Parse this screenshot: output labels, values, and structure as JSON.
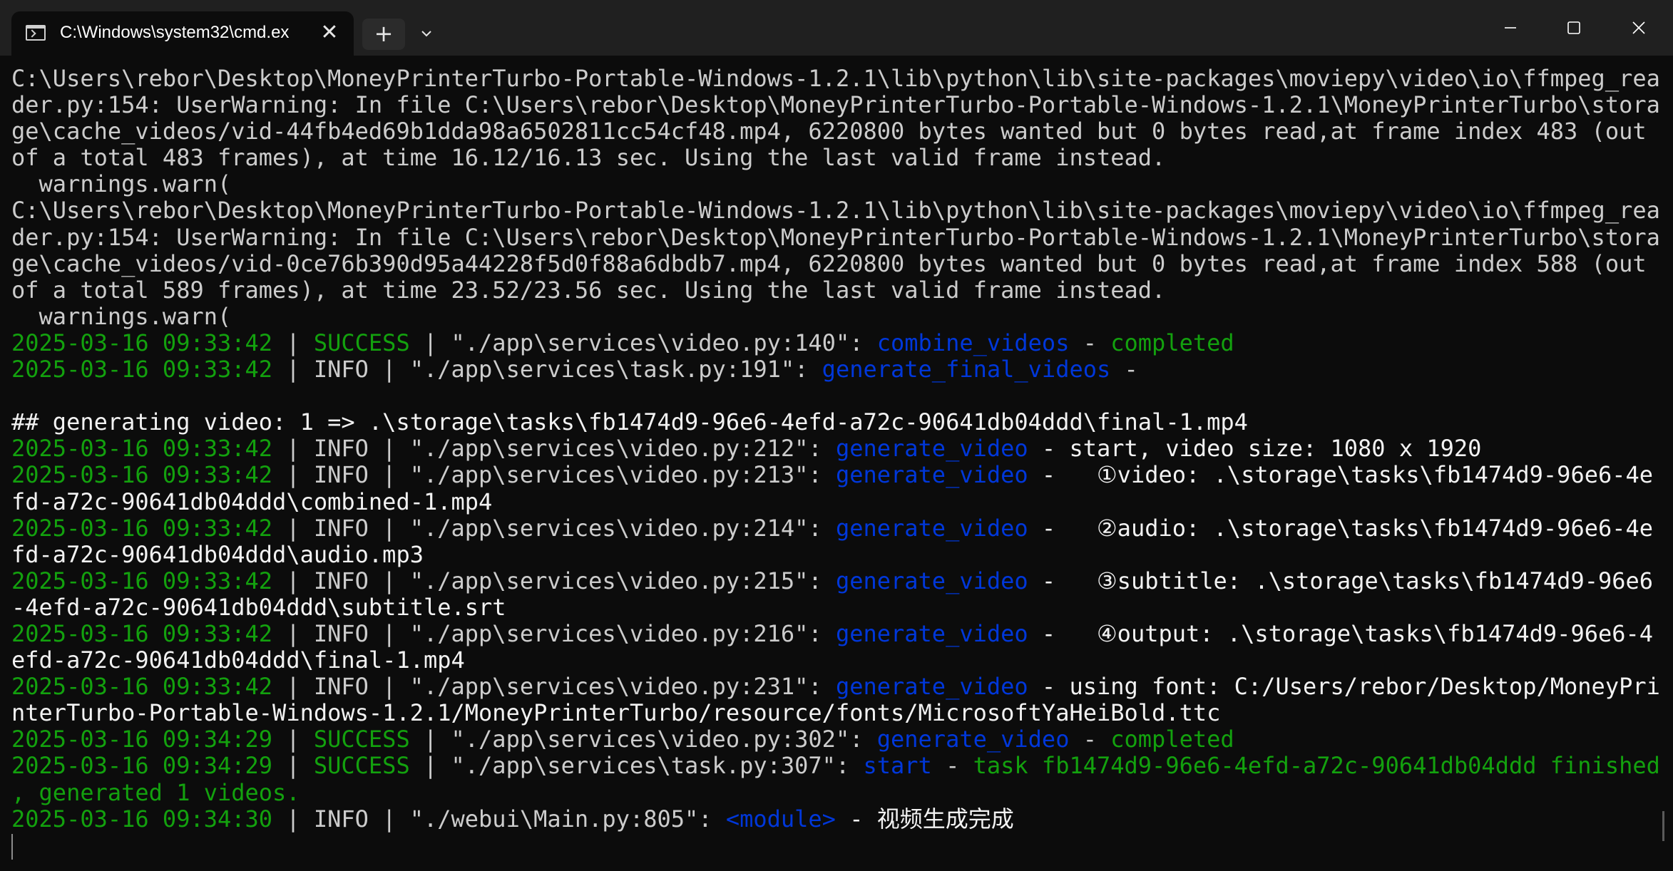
{
  "window": {
    "tab_title": "C:\\Windows\\system32\\cmd.ex",
    "new_tab_glyph": "+",
    "close_tab_glyph": "✕"
  },
  "icons": {
    "tab": "terminal-icon",
    "close_tab": "close-icon",
    "new_tab": "plus-icon",
    "dropdown": "chevron-down-icon",
    "minimize": "minimize-icon",
    "maximize": "maximize-icon",
    "close_window": "close-icon"
  },
  "colors": {
    "background": "#0c0c0c",
    "titlebar": "#202020",
    "text": "#cccccc",
    "green": "#13a10e",
    "blue": "#0037da",
    "white": "#f2f2f2"
  },
  "terminal": {
    "lines": [
      [
        {
          "t": "C:\\Users\\rebor\\Desktop\\MoneyPrinterTurbo-Portable-Windows-1.2.1\\lib\\python\\lib\\site-packages\\moviepy\\video\\io\\ffmpeg_rea"
        }
      ],
      [
        {
          "t": "der.py:154: UserWarning: In file C:\\Users\\rebor\\Desktop\\MoneyPrinterTurbo-Portable-Windows-1.2.1\\MoneyPrinterTurbo\\stora"
        }
      ],
      [
        {
          "t": "ge\\cache_videos/vid-44fb4ed69b1dda98a6502811cc54cf48.mp4, 6220800 bytes wanted but 0 bytes read,at frame index 483 (out"
        }
      ],
      [
        {
          "t": "of a total 483 frames), at time 16.12/16.13 sec. Using the last valid frame instead."
        }
      ],
      [
        {
          "t": "  warnings.warn("
        }
      ],
      [
        {
          "t": "C:\\Users\\rebor\\Desktop\\MoneyPrinterTurbo-Portable-Windows-1.2.1\\lib\\python\\lib\\site-packages\\moviepy\\video\\io\\ffmpeg_rea"
        }
      ],
      [
        {
          "t": "der.py:154: UserWarning: In file C:\\Users\\rebor\\Desktop\\MoneyPrinterTurbo-Portable-Windows-1.2.1\\MoneyPrinterTurbo\\stora"
        }
      ],
      [
        {
          "t": "ge\\cache_videos/vid-0ce76b390d95a44228f5d0f88a6dbdb7.mp4, 6220800 bytes wanted but 0 bytes read,at frame index 588 (out"
        }
      ],
      [
        {
          "t": "of a total 589 frames), at time 23.52/23.56 sec. Using the last valid frame instead."
        }
      ],
      [
        {
          "t": "  warnings.warn("
        }
      ],
      [
        {
          "t": "2025-03-16 09:33:42",
          "c": "green"
        },
        {
          "t": " | "
        },
        {
          "t": "SUCCESS",
          "c": "green"
        },
        {
          "t": " | \"./app\\services\\video.py:140\": "
        },
        {
          "t": "combine_videos",
          "c": "blue"
        },
        {
          "t": " - "
        },
        {
          "t": "completed",
          "c": "green"
        }
      ],
      [
        {
          "t": "2025-03-16 09:33:42",
          "c": "green"
        },
        {
          "t": " | INFO | \"./app\\services\\task.py:191\": "
        },
        {
          "t": "generate_final_videos",
          "c": "blue"
        },
        {
          "t": " -"
        }
      ],
      [
        {
          "t": ""
        }
      ],
      [
        {
          "t": "## generating video: 1 => .\\storage\\tasks\\fb1474d9-96e6-4efd-a72c-90641db04ddd\\final-1.mp4",
          "c": "white"
        }
      ],
      [
        {
          "t": "2025-03-16 09:33:42",
          "c": "green"
        },
        {
          "t": " | INFO | \"./app\\services\\video.py:212\": "
        },
        {
          "t": "generate_video",
          "c": "blue"
        },
        {
          "t": " - start, video size: 1080 x 1920",
          "c": "white"
        }
      ],
      [
        {
          "t": "2025-03-16 09:33:42",
          "c": "green"
        },
        {
          "t": " | INFO | \"./app\\services\\video.py:213\": "
        },
        {
          "t": "generate_video",
          "c": "blue"
        },
        {
          "t": " -   ①video: .\\storage\\tasks\\fb1474d9-96e6-4e",
          "c": "white"
        }
      ],
      [
        {
          "t": "fd-a72c-90641db04ddd\\combined-1.mp4",
          "c": "white"
        }
      ],
      [
        {
          "t": "2025-03-16 09:33:42",
          "c": "green"
        },
        {
          "t": " | INFO | \"./app\\services\\video.py:214\": "
        },
        {
          "t": "generate_video",
          "c": "blue"
        },
        {
          "t": " -   ②audio: .\\storage\\tasks\\fb1474d9-96e6-4e",
          "c": "white"
        }
      ],
      [
        {
          "t": "fd-a72c-90641db04ddd\\audio.mp3",
          "c": "white"
        }
      ],
      [
        {
          "t": "2025-03-16 09:33:42",
          "c": "green"
        },
        {
          "t": " | INFO | \"./app\\services\\video.py:215\": "
        },
        {
          "t": "generate_video",
          "c": "blue"
        },
        {
          "t": " -   ③subtitle: .\\storage\\tasks\\fb1474d9-96e6",
          "c": "white"
        }
      ],
      [
        {
          "t": "-4efd-a72c-90641db04ddd\\subtitle.srt",
          "c": "white"
        }
      ],
      [
        {
          "t": "2025-03-16 09:33:42",
          "c": "green"
        },
        {
          "t": " | INFO | \"./app\\services\\video.py:216\": "
        },
        {
          "t": "generate_video",
          "c": "blue"
        },
        {
          "t": " -   ④output: .\\storage\\tasks\\fb1474d9-96e6-4",
          "c": "white"
        }
      ],
      [
        {
          "t": "efd-a72c-90641db04ddd\\final-1.mp4",
          "c": "white"
        }
      ],
      [
        {
          "t": "2025-03-16 09:33:42",
          "c": "green"
        },
        {
          "t": " | INFO | \"./app\\services\\video.py:231\": "
        },
        {
          "t": "generate_video",
          "c": "blue"
        },
        {
          "t": " - using font: C:/Users/rebor/Desktop/MoneyPri",
          "c": "white"
        }
      ],
      [
        {
          "t": "nterTurbo-Portable-Windows-1.2.1/MoneyPrinterTurbo/resource/fonts/MicrosoftYaHeiBold.ttc",
          "c": "white"
        }
      ],
      [
        {
          "t": "2025-03-16 09:34:29",
          "c": "green"
        },
        {
          "t": " | "
        },
        {
          "t": "SUCCESS",
          "c": "green"
        },
        {
          "t": " | \"./app\\services\\video.py:302\": "
        },
        {
          "t": "generate_video",
          "c": "blue"
        },
        {
          "t": " - "
        },
        {
          "t": "completed",
          "c": "green"
        }
      ],
      [
        {
          "t": "2025-03-16 09:34:29",
          "c": "green"
        },
        {
          "t": " | "
        },
        {
          "t": "SUCCESS",
          "c": "green"
        },
        {
          "t": " | \"./app\\services\\task.py:307\": "
        },
        {
          "t": "start",
          "c": "blue"
        },
        {
          "t": " - "
        },
        {
          "t": "task fb1474d9-96e6-4efd-a72c-90641db04ddd finished",
          "c": "green"
        }
      ],
      [
        {
          "t": ", generated 1 videos.",
          "c": "green"
        }
      ],
      [
        {
          "t": "2025-03-16 09:34:30",
          "c": "green"
        },
        {
          "t": " | INFO | \"./webui\\Main.py:805\": "
        },
        {
          "t": "<module>",
          "c": "blue"
        },
        {
          "t": " - 视频生成完成",
          "c": "white"
        }
      ]
    ]
  }
}
